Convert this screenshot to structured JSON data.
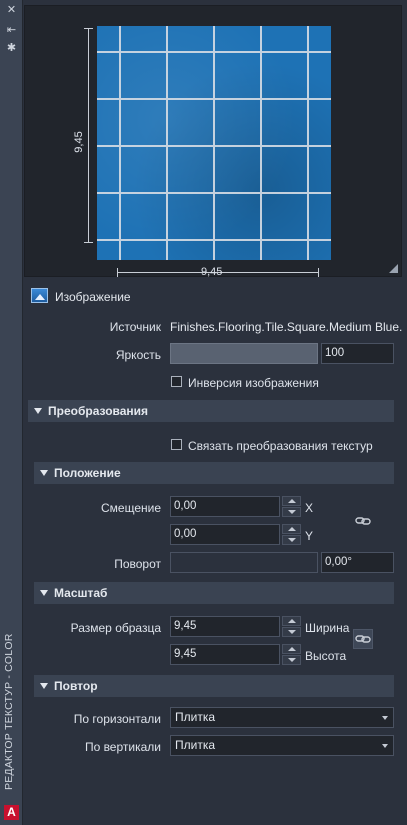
{
  "palette": {
    "tile_blue": "#1e72b5",
    "grout": "#d7dde5",
    "panel_bg": "#2b313d",
    "section_bg": "#3a4352",
    "app_red": "#c8102e"
  },
  "strip": {
    "title": "РЕДАКТОР ТЕКСТУР - COLOR",
    "buttons": [
      "close-icon",
      "pin-icon",
      "settings-icon"
    ],
    "app_logo": "A"
  },
  "preview": {
    "width_label": "9,45",
    "height_label": "9,45"
  },
  "image": {
    "title": "Изображение",
    "source_label": "Источник",
    "source_value": "Finishes.Flooring.Tile.Square.Medium Blue.",
    "brightness_label": "Яркость",
    "brightness_value": "100",
    "invert_label": "Инверсия изображения",
    "invert_checked": false
  },
  "transforms": {
    "title": "Преобразования",
    "link_label": "Связать преобразования текстур",
    "link_checked": false,
    "position": {
      "title": "Положение",
      "offset_label": "Смещение",
      "x_value": "0,00",
      "y_value": "0,00",
      "x_axis": "X",
      "y_axis": "Y",
      "rotation_label": "Поворот",
      "rotation_value": "0,00°"
    },
    "scale": {
      "title": "Масштаб",
      "sample_size_label": "Размер образца",
      "width_value": "9,45",
      "height_value": "9,45",
      "width_label": "Ширина",
      "height_label": "Высота"
    },
    "repeat": {
      "title": "Повтор",
      "horizontal_label": "По горизонтали",
      "horizontal_value": "Плитка",
      "vertical_label": "По вертикали",
      "vertical_value": "Плитка"
    }
  }
}
